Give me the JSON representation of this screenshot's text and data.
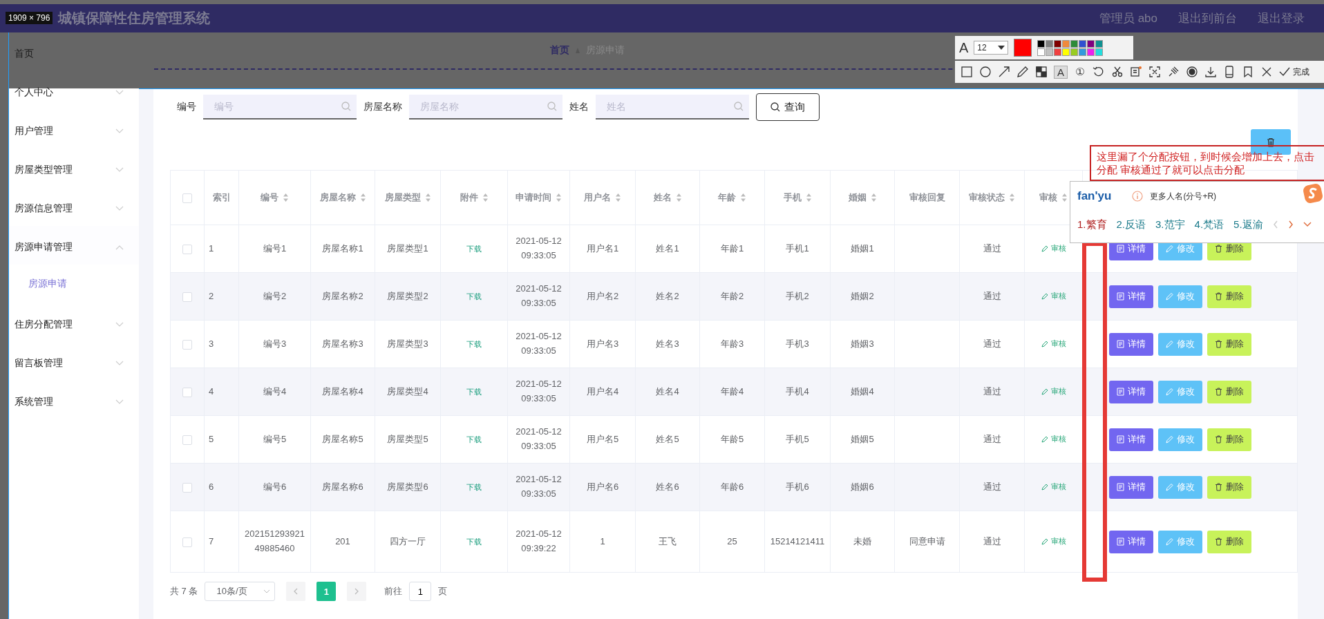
{
  "header": {
    "title": "城镇保障性住房管理系统",
    "user": "管理员 abo",
    "links": [
      "退出到前台",
      "退出登录"
    ]
  },
  "sidebar": {
    "items": [
      {
        "label": "首页"
      },
      {
        "label": "个人中心",
        "expanded": false
      },
      {
        "label": "用户管理",
        "expanded": false
      },
      {
        "label": "房屋类型管理",
        "expanded": false
      },
      {
        "label": "房源信息管理",
        "expanded": false
      },
      {
        "label": "房源申请管理",
        "expanded": true,
        "children": [
          {
            "label": "房源申请",
            "selected": true
          }
        ]
      },
      {
        "label": "住房分配管理",
        "expanded": false
      },
      {
        "label": "留言板管理",
        "expanded": false
      },
      {
        "label": "系统管理",
        "expanded": false
      }
    ]
  },
  "breadcrumb": [
    "首页",
    "房源申请"
  ],
  "search": {
    "fields": [
      {
        "label": "编号",
        "placeholder": "编号"
      },
      {
        "label": "房屋名称",
        "placeholder": "房屋名称"
      },
      {
        "label": "姓名",
        "placeholder": "姓名"
      }
    ],
    "button": "查询"
  },
  "table": {
    "all_checked": false,
    "columns": [
      {
        "label": "索引",
        "sortable": false
      },
      {
        "label": "编号",
        "sortable": true
      },
      {
        "label": "房屋名称",
        "sortable": true
      },
      {
        "label": "房屋类型",
        "sortable": true
      },
      {
        "label": "附件",
        "sortable": true
      },
      {
        "label": "申请时间",
        "sortable": true
      },
      {
        "label": "用户名",
        "sortable": true
      },
      {
        "label": "姓名",
        "sortable": true
      },
      {
        "label": "年龄",
        "sortable": true
      },
      {
        "label": "手机",
        "sortable": true
      },
      {
        "label": "婚姻",
        "sortable": true
      },
      {
        "label": "审核回复",
        "sortable": false
      },
      {
        "label": "审核状态",
        "sortable": true
      },
      {
        "label": "审核",
        "sortable": true
      }
    ],
    "rows": [
      {
        "checked": false,
        "cells": [
          "1",
          "编号1",
          "房屋名称1",
          "房屋类型1",
          "下载",
          "2021-05-12 09:33:05",
          "用户名1",
          "姓名1",
          "年龄1",
          "手机1",
          "婚姻1",
          null,
          "通过"
        ],
        "review": "审核",
        "actions": [
          {
            "kind": "detail",
            "label": "详情"
          },
          {
            "kind": "edit",
            "label": "修改"
          },
          {
            "kind": "delete",
            "label": "删除"
          }
        ]
      },
      {
        "checked": false,
        "cells": [
          "2",
          "编号2",
          "房屋名称2",
          "房屋类型2",
          "下载",
          "2021-05-12 09:33:05",
          "用户名2",
          "姓名2",
          "年龄2",
          "手机2",
          "婚姻2",
          null,
          "通过"
        ],
        "review": "审核",
        "actions": [
          {
            "kind": "detail",
            "label": "详情"
          },
          {
            "kind": "edit",
            "label": "修改"
          },
          {
            "kind": "delete",
            "label": "删除"
          }
        ]
      },
      {
        "checked": false,
        "cells": [
          "3",
          "编号3",
          "房屋名称3",
          "房屋类型3",
          "下载",
          "2021-05-12 09:33:05",
          "用户名3",
          "姓名3",
          "年龄3",
          "手机3",
          "婚姻3",
          null,
          "通过"
        ],
        "review": "审核",
        "actions": [
          {
            "kind": "detail",
            "label": "详情"
          },
          {
            "kind": "edit",
            "label": "修改"
          },
          {
            "kind": "delete",
            "label": "删除"
          }
        ]
      },
      {
        "checked": false,
        "cells": [
          "4",
          "编号4",
          "房屋名称4",
          "房屋类型4",
          "下载",
          "2021-05-12 09:33:05",
          "用户名4",
          "姓名4",
          "年龄4",
          "手机4",
          "婚姻4",
          null,
          "通过"
        ],
        "review": "审核",
        "actions": [
          {
            "kind": "detail",
            "label": "详情"
          },
          {
            "kind": "edit",
            "label": "修改"
          },
          {
            "kind": "delete",
            "label": "删除"
          }
        ]
      },
      {
        "checked": false,
        "cells": [
          "5",
          "编号5",
          "房屋名称5",
          "房屋类型5",
          "下载",
          "2021-05-12 09:33:05",
          "用户名5",
          "姓名5",
          "年龄5",
          "手机5",
          "婚姻5",
          null,
          "通过"
        ],
        "review": "审核",
        "actions": [
          {
            "kind": "detail",
            "label": "详情"
          },
          {
            "kind": "edit",
            "label": "修改"
          },
          {
            "kind": "delete",
            "label": "删除"
          }
        ]
      },
      {
        "checked": false,
        "cells": [
          "6",
          "编号6",
          "房屋名称6",
          "房屋类型6",
          "下载",
          "2021-05-12 09:33:05",
          "用户名6",
          "姓名6",
          "年龄6",
          "手机6",
          "婚姻6",
          null,
          "通过"
        ],
        "review": "审核",
        "actions": [
          {
            "kind": "detail",
            "label": "详情"
          },
          {
            "kind": "edit",
            "label": "修改"
          },
          {
            "kind": "delete",
            "label": "删除"
          }
        ]
      },
      {
        "checked": false,
        "cells": [
          "7",
          "20215129392149885460",
          "201",
          "四方一厅",
          "下载",
          "2021-05-12 09:39:22",
          "1",
          "王飞",
          "25",
          "15214121411",
          "未婚",
          "同意申请",
          "通过"
        ],
        "review": "审核",
        "actions": [
          {
            "kind": "detail",
            "label": "详情"
          },
          {
            "kind": "edit",
            "label": "修改"
          },
          {
            "kind": "delete",
            "label": "删除"
          }
        ]
      }
    ]
  },
  "pagination": {
    "total": "共 7 条",
    "page_size": "10条/页",
    "pages": [
      {
        "label": "1",
        "selected": true
      }
    ],
    "goto_label": "前往",
    "goto_value": "1",
    "goto_suffix": "页"
  },
  "screenshot_tool": {
    "size_label": "1909 × 796",
    "font_glyph": "A",
    "font_size": "12",
    "palette": [
      {
        "color": "#000000"
      },
      {
        "color": "#808080"
      },
      {
        "color": "#800000"
      },
      {
        "color": "#f08a3c"
      },
      {
        "color": "#2e8b3a"
      },
      {
        "color": "#3050d0"
      },
      {
        "color": "#800080"
      },
      {
        "color": "#109090"
      },
      {
        "color": "#ffffff"
      },
      {
        "color": "#c0c0c0"
      },
      {
        "color": "#f04040"
      },
      {
        "color": "#ffff00"
      },
      {
        "color": "#99cc22"
      },
      {
        "color": "#3399dd"
      },
      {
        "color": "#ee22ee"
      },
      {
        "color": "#22dddd"
      }
    ],
    "text_tool_glyph": "A",
    "number_tool_glyph": "①",
    "done": "完成",
    "note": "这里漏了个分配按钮，到时候会增加上去，点击分配 审核通过了就可以点击分配"
  },
  "ime": {
    "input": "fan'yu",
    "hint": "更多人名(分号+R)",
    "candidates": [
      {
        "label": "1.繁育",
        "selected": true
      },
      {
        "label": "2.反语",
        "selected": false
      },
      {
        "label": "3.范宇",
        "selected": false
      },
      {
        "label": "4.梵语",
        "selected": false
      },
      {
        "label": "5.返渝",
        "selected": false
      }
    ]
  }
}
